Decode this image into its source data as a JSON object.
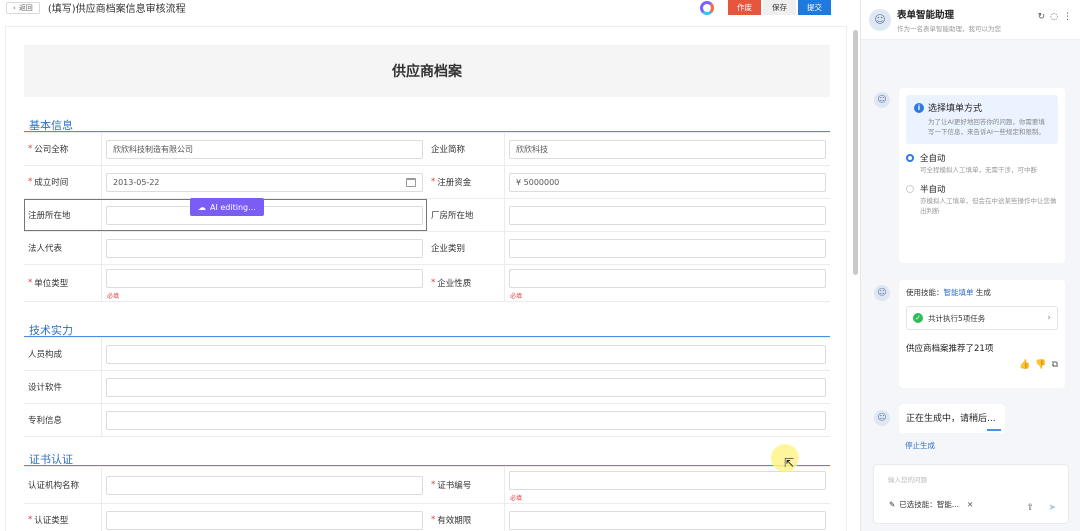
{
  "topbar": {
    "back_label": "返回",
    "title": "(填写)供应商档案信息审核流程",
    "btn_void": "作废",
    "btn_save": "保存",
    "btn_submit": "提交"
  },
  "form": {
    "header": "供应商档案",
    "sections": {
      "basic": "基本信息",
      "tech": "技术实力",
      "cert": "证书认证"
    },
    "basic_rows": [
      {
        "l_label": "公司全称",
        "l_req": true,
        "l_value": "欣欣科技制造有限公司",
        "r_label": "企业简称",
        "r_req": false,
        "r_value": "欣欣科技"
      },
      {
        "l_label": "成立时间",
        "l_req": true,
        "l_value": "2013-05-22",
        "r_label": "注册资金",
        "r_req": true,
        "r_value": "¥ 5000000"
      },
      {
        "l_label": "注册所在地",
        "l_req": false,
        "l_value": "",
        "r_label": "厂房所在地",
        "r_req": false,
        "r_value": ""
      },
      {
        "l_label": "法人代表",
        "l_req": false,
        "l_value": "",
        "r_label": "企业类别",
        "r_req": false,
        "r_value": ""
      },
      {
        "l_label": "单位类型",
        "l_req": true,
        "l_value": "",
        "l_hint": "必填",
        "r_label": "企业性质",
        "r_req": true,
        "r_value": "",
        "r_hint": "必填"
      }
    ],
    "tech_rows": [
      {
        "label": "人员构成",
        "value": ""
      },
      {
        "label": "设计软件",
        "value": ""
      },
      {
        "label": "专利信息",
        "value": ""
      }
    ],
    "cert_rows": [
      {
        "l_label": "认证机构名称",
        "l_req": false,
        "r_label": "证书编号",
        "r_req": true,
        "r_hint": "必填"
      },
      {
        "l_label": "认证类型",
        "l_req": true,
        "r_label": "有效期限",
        "r_req": true
      }
    ],
    "ai_editing": "AI editing..."
  },
  "assistant": {
    "title": "表单智能助理",
    "subtitle": "作为一名表单智能助理，我可以为您",
    "mode_card": {
      "title": "选择填单方式",
      "desc": "为了让AI更好地回答你的问题，你需要填写一下信息，来告诉AI一些规定和限制。",
      "options": [
        {
          "label": "全自动",
          "desc": "可全程模拟人工填单，无需干涉，可中断",
          "selected": true
        },
        {
          "label": "半自动",
          "desc": "亦模拟人工填单，但会在中途某些操作中让您做出判断",
          "selected": false
        }
      ]
    },
    "skill_card": {
      "prefix": "使用技能：",
      "skill": "智能填单",
      "suffix": "生成",
      "task": "共计执行5项任务",
      "result": "供应商档案推荐了21项"
    },
    "generating": "正在生成中，请稍后...",
    "stop": "停止生成",
    "input_placeholder": "输入您的问题",
    "chip": "已选技能：智能..."
  }
}
